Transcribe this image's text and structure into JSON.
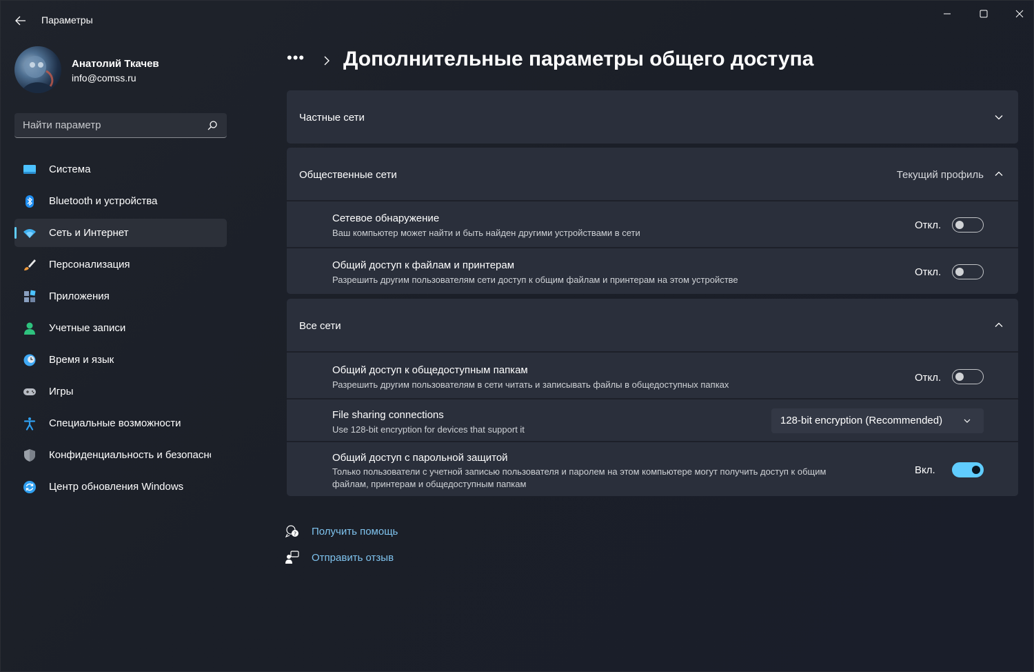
{
  "window": {
    "title": "Параметры"
  },
  "profile": {
    "name": "Анатолий Ткачев",
    "email": "info@comss.ru"
  },
  "search": {
    "placeholder": "Найти параметр"
  },
  "sidebar": {
    "items": [
      {
        "label": "Система",
        "icon": "system-icon",
        "color": "#4cc2ff"
      },
      {
        "label": "Bluetooth и устройства",
        "icon": "bluetooth-icon",
        "color": "#1f8ef1"
      },
      {
        "label": "Сеть и Интернет",
        "icon": "wifi-icon",
        "color": "#3fb0f0",
        "active": true
      },
      {
        "label": "Персонализация",
        "icon": "brush-icon",
        "color": "#f09a3a"
      },
      {
        "label": "Приложения",
        "icon": "apps-icon",
        "color": "#8aa0c0"
      },
      {
        "label": "Учетные записи",
        "icon": "user-icon",
        "color": "#2ec27e"
      },
      {
        "label": "Время и язык",
        "icon": "clock-globe-icon",
        "color": "#3fa9f5"
      },
      {
        "label": "Игры",
        "icon": "gamepad-icon",
        "color": "#b8bcc4"
      },
      {
        "label": "Специальные возможности",
        "icon": "accessibility-icon",
        "color": "#2f9ff0"
      },
      {
        "label": "Конфиденциальность и безопасность",
        "icon": "shield-icon",
        "color": "#9aa0a8"
      },
      {
        "label": "Центр обновления Windows",
        "icon": "update-icon",
        "color": "#2f9ff0"
      }
    ]
  },
  "header": {
    "breadcrumb_dots": "•••",
    "title": "Дополнительные параметры общего доступа"
  },
  "sections": {
    "private": {
      "title": "Частные сети",
      "expanded": false
    },
    "public": {
      "title": "Общественные сети",
      "note": "Текущий профиль",
      "expanded": true,
      "rows": [
        {
          "title": "Сетевое обнаружение",
          "subtitle": "Ваш компьютер может найти и быть найден другими устройствами в сети",
          "state": "Откл.",
          "on": false
        },
        {
          "title": "Общий доступ к файлам и принтерам",
          "subtitle": "Разрешить другим пользователям сети доступ к общим файлам и принтерам на этом устройстве",
          "state": "Откл.",
          "on": false
        }
      ]
    },
    "all": {
      "title": "Все сети",
      "expanded": true,
      "rows": [
        {
          "title": "Общий доступ к общедоступным папкам",
          "subtitle": "Разрешить другим пользователям в сети читать и записывать файлы в общедоступных папках",
          "state": "Откл.",
          "on": false
        },
        {
          "title": "File sharing connections",
          "subtitle": "Use 128-bit encryption for devices that support it",
          "select_value": "128-bit encryption (Recommended)"
        },
        {
          "title": "Общий доступ с парольной защитой",
          "subtitle": "Только пользователи с учетной записью пользователя и паролем на этом компьютере могут получить доступ к общим файлам, принтерам и общедоступным папкам",
          "state": "Вкл.",
          "on": true
        }
      ]
    }
  },
  "links": {
    "help": "Получить помощь",
    "feedback": "Отправить отзыв"
  },
  "colors": {
    "accent": "#60cdff",
    "link": "#7fc3ee",
    "card": "#2a2f3b"
  }
}
